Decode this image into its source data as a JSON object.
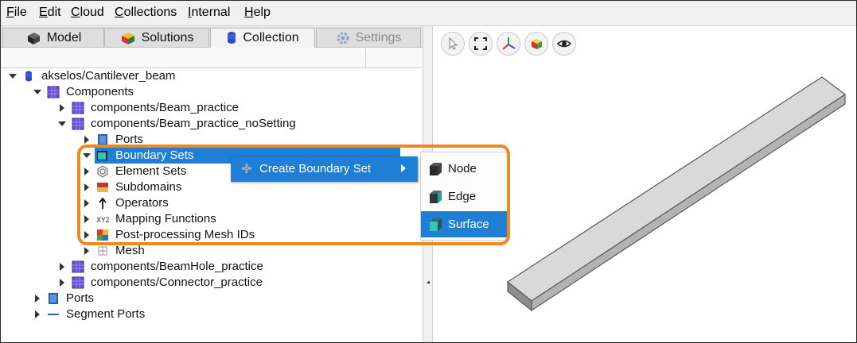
{
  "menubar": {
    "items": [
      {
        "label": "File",
        "accel": "F",
        "rest": "ile"
      },
      {
        "label": "Edit",
        "accel": "E",
        "rest": "dit"
      },
      {
        "label": "Cloud",
        "accel": "C",
        "rest": "loud"
      },
      {
        "label": "Collections",
        "accel": "C",
        "rest": "ollections"
      },
      {
        "label": "Internal",
        "accel": "I",
        "rest": "nternal"
      },
      {
        "label": "Help",
        "accel": "H",
        "rest": "elp"
      }
    ]
  },
  "tabs": [
    {
      "label": "Model",
      "icon": "model-icon",
      "state": "normal"
    },
    {
      "label": "Solutions",
      "icon": "solutions-icon",
      "state": "normal"
    },
    {
      "label": "Collection",
      "icon": "collection-icon",
      "state": "active"
    },
    {
      "label": "Settings",
      "icon": "gear-icon",
      "state": "disabled"
    }
  ],
  "tree": [
    {
      "label": "akselos/Cantilever_beam",
      "expanded": true,
      "icon": "collection-icon"
    },
    {
      "label": "Components",
      "expanded": true,
      "icon": "components-icon"
    },
    {
      "label": "components/Beam_practice",
      "expanded": false,
      "icon": "component-icon"
    },
    {
      "label": "components/Beam_practice_noSetting",
      "expanded": true,
      "icon": "component-icon"
    },
    {
      "label": "Ports",
      "expanded": false,
      "icon": "ports-icon"
    },
    {
      "label": "Boundary Sets",
      "expanded": true,
      "icon": "boundary-sets-icon",
      "selected": true
    },
    {
      "label": "Element Sets",
      "expanded": false,
      "icon": "element-sets-icon"
    },
    {
      "label": "Subdomains",
      "expanded": false,
      "icon": "subdomains-icon"
    },
    {
      "label": "Operators",
      "expanded": false,
      "icon": "operators-icon"
    },
    {
      "label": "Mapping Functions",
      "expanded": false,
      "icon": "mapping-functions-icon"
    },
    {
      "label": "Post-processing Mesh IDs",
      "expanded": false,
      "icon": "post-processing-icon"
    },
    {
      "label": "Mesh",
      "expanded": false,
      "icon": "mesh-icon"
    },
    {
      "label": "components/BeamHole_practice",
      "expanded": false,
      "icon": "component-icon"
    },
    {
      "label": "components/Connector_practice",
      "expanded": false,
      "icon": "component-icon"
    },
    {
      "label": "Ports",
      "expanded": false,
      "icon": "ports-icon"
    },
    {
      "label": "Segment Ports",
      "expanded": false,
      "icon": "segment-ports-icon"
    }
  ],
  "context_menu": {
    "item_label": "Create Boundary Set",
    "submenu": [
      {
        "label": "Node",
        "active": false
      },
      {
        "label": "Edge",
        "active": false
      },
      {
        "label": "Surface",
        "active": true
      }
    ]
  },
  "viewport_toolbar": [
    "select-cursor-icon",
    "fit-view-icon",
    "axes-icon",
    "view-cube-icon",
    "eye-icon"
  ],
  "colors": {
    "selection": "#1f7fd4",
    "annotation": "#f0881e",
    "component": "#6a4fd8"
  }
}
